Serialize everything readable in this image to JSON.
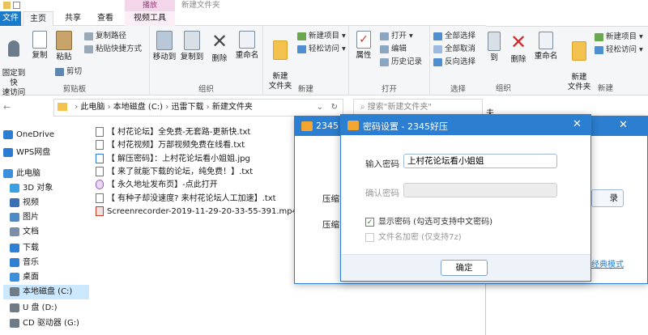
{
  "explorer": {
    "title": "新建文件夹",
    "context_tab": "播放",
    "tabs": [
      "文件",
      "主页",
      "共享",
      "查看",
      "视频工具"
    ],
    "ribbon": {
      "clipboard": {
        "pin": "固定到快\n速访问",
        "copy": "复制",
        "paste": "粘贴",
        "copy_path": "复制路径",
        "paste_shortcut": "粘贴快捷方式",
        "cut": "剪切",
        "label": "剪贴板"
      },
      "organize": {
        "move_to": "移动到",
        "copy_to": "复制到",
        "delete": "删除",
        "rename": "重命名",
        "label": "组织"
      },
      "new": {
        "new_folder": "新建\n文件夹",
        "new_item": "新建项目 ▾",
        "easy_access": "轻松访问 ▾",
        "label": "新建"
      },
      "open": {
        "properties": "属性",
        "open": "打开 ▾",
        "edit": "编辑",
        "history": "历史记录",
        "label": "打开"
      },
      "select": {
        "select_all": "全部选择",
        "select_none": "全部取消",
        "invert": "反向选择",
        "label": "选择"
      }
    },
    "breadcrumb": [
      "此电脑",
      "本地磁盘 (C:)",
      "迅雷下载",
      "新建文件夹"
    ],
    "search_placeholder": "搜索\"新建文件夹\"",
    "nav": [
      {
        "label": "OneDrive",
        "icon": "cloud-icon",
        "color": "#2b7cd3"
      },
      {
        "label": "WPS网盘",
        "icon": "cloud-icon",
        "color": "#2b7cd3"
      },
      {
        "label": "此电脑",
        "icon": "computer-icon",
        "color": "#3c8fdc"
      },
      {
        "label": "3D 对象",
        "icon": "cube-icon",
        "color": "#3aa0e0"
      },
      {
        "label": "视频",
        "icon": "video-icon",
        "color": "#3c6fb4"
      },
      {
        "label": "图片",
        "icon": "picture-icon",
        "color": "#4d8ac6"
      },
      {
        "label": "文档",
        "icon": "document-icon",
        "color": "#7a8fa6"
      },
      {
        "label": "下载",
        "icon": "download-icon",
        "color": "#2e80d2"
      },
      {
        "label": "音乐",
        "icon": "music-icon",
        "color": "#2e80d2"
      },
      {
        "label": "桌面",
        "icon": "desktop-icon",
        "color": "#3c8fdc"
      },
      {
        "label": "本地磁盘 (C:)",
        "icon": "drive-icon",
        "color": "#6f7b86"
      },
      {
        "label": "U 盘 (D:)",
        "icon": "drive-icon",
        "color": "#6f7b86"
      },
      {
        "label": "CD 驱动器 (G:)",
        "icon": "disc-icon",
        "color": "#6f7b86"
      }
    ],
    "files": [
      "【 村花论坛】全免费-无套路-更新快.txt",
      "【 村花视频】万部视频免费在线看.txt",
      "【 解压密码】：上村花论坛看小姐姐.jpg",
      "【 来了就能下载的论坛，纯免费！】.txt",
      "【 永久地址发布页】-点此打开",
      "【 有种子却没速度? 来村花论坛人工加速】.txt",
      "Screenrecorder-2019-11-29-20-33-55-391.mp4"
    ]
  },
  "explorer2": {
    "delete": "删除",
    "rename": "重命名",
    "new_folder": "新建\n文件夹",
    "new_item": "新建项目 ▾",
    "easy_access": "轻松访问 ▾",
    "organize_label": "组织",
    "new_label": "新建",
    "partial_label": "到",
    "partial_addr": "夫"
  },
  "zip": {
    "title": "2345",
    "row1": "压缩",
    "row2": "压缩",
    "button_partial": "录",
    "link": "经典模式"
  },
  "password_dialog": {
    "title": "密码设置 - 2345好压",
    "password_label": "输入密码",
    "password_value": "上村花论坛看小姐姐",
    "confirm_label": "确认密码",
    "show_password": "显示密码 (勾选可支持中文密码)",
    "encrypt_names": "文件名加密 (仅支持7z)",
    "ok": "确定"
  }
}
